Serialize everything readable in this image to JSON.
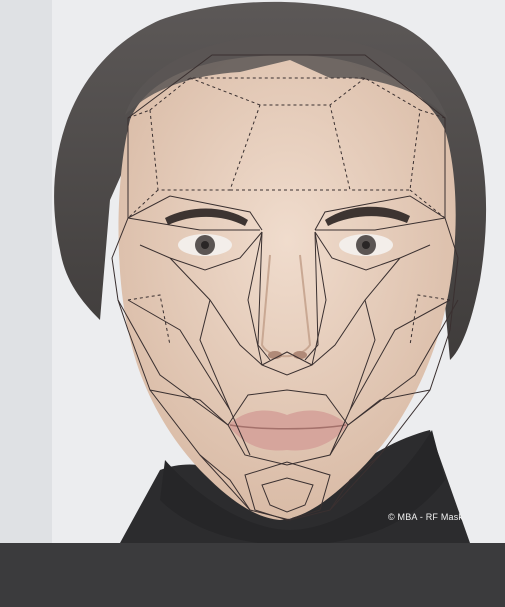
{
  "photo": {
    "credit": "© MBA - RF Mask"
  },
  "colors": {
    "background": "#ecedef",
    "hair": "#4f4c4b",
    "skin": "#e7cfbe",
    "sweater": "#2c2c2e",
    "mask_lines": "#3a3030",
    "footer": "#3b3b3d"
  }
}
